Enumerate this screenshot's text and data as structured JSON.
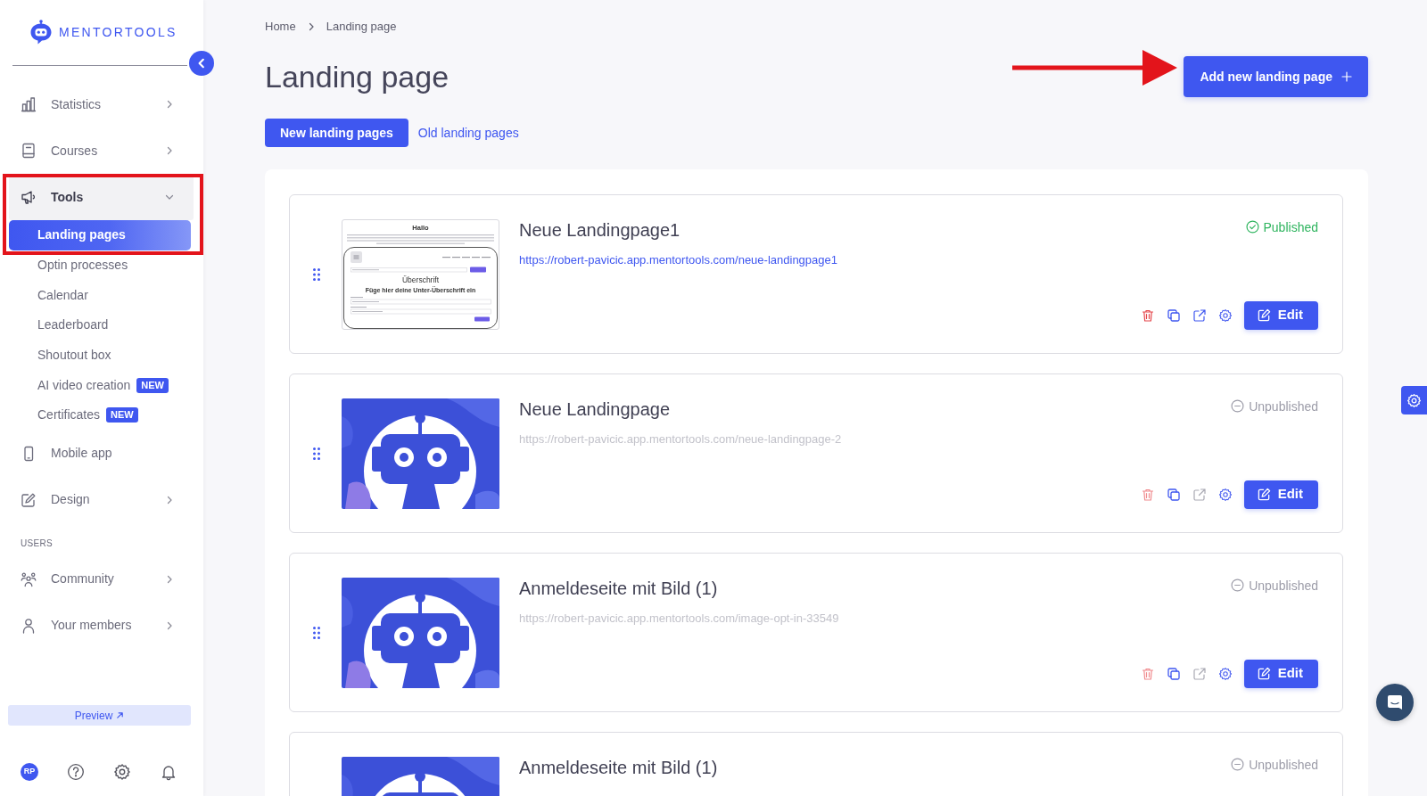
{
  "sidebar": {
    "logo": "MENTORTOOLS",
    "sections": [
      {
        "items": [
          {
            "kind": "group",
            "label": "Statistics",
            "expanded": false
          },
          {
            "kind": "group",
            "label": "Courses",
            "expanded": false
          },
          {
            "kind": "group",
            "label": "Tools",
            "expanded": true,
            "annotated": true,
            "children": [
              {
                "label": "Landing pages",
                "selected": true
              },
              {
                "label": "Optin processes",
                "selected": false
              },
              {
                "label": "Calendar",
                "selected": false
              },
              {
                "label": "Leaderboard",
                "selected": false
              },
              {
                "label": "Shoutout box",
                "selected": false
              },
              {
                "label": "AI video creation",
                "selected": false,
                "badge": "NEW"
              },
              {
                "label": "Certificates",
                "selected": false,
                "badge": "NEW"
              }
            ]
          },
          {
            "kind": "link",
            "label": "Mobile app"
          },
          {
            "kind": "group",
            "label": "Design",
            "expanded": false
          }
        ]
      },
      {
        "heading": "USERS",
        "items": [
          {
            "kind": "group",
            "label": "Community",
            "expanded": false
          },
          {
            "kind": "group",
            "label": "Your members",
            "expanded": false
          }
        ]
      }
    ],
    "preview_button": "Preview",
    "user_initials": "RP"
  },
  "breadcrumb": [
    {
      "label": "Home"
    },
    {
      "label": "Landing page"
    }
  ],
  "title": "Landing page",
  "add_button": {
    "label": "Add new landing page",
    "annotated": true
  },
  "tabs": [
    {
      "label": "New landing pages",
      "selected": true
    },
    {
      "label": "Old landing pages",
      "selected": false
    }
  ],
  "landing_pages": [
    {
      "thumbnail": {
        "kind": "page-preview",
        "heading": "Hallo",
        "headline": "Überschrift",
        "subheadline": "Füge hier deine Unter-Überschrift ein"
      },
      "title": "Neue Landingpage1",
      "url": "https://robert-pavicic.app.mentortools.com/neue-landingpage1",
      "published": true,
      "status": "Published",
      "edit_label": "Edit"
    },
    {
      "thumbnail": {
        "kind": "robot"
      },
      "title": "Neue Landingpage",
      "url": "https://robert-pavicic.app.mentortools.com/neue-landingpage-2",
      "published": false,
      "status": "Unpublished",
      "edit_label": "Edit"
    },
    {
      "thumbnail": {
        "kind": "robot"
      },
      "title": "Anmeldeseite mit Bild (1)",
      "url": "https://robert-pavicic.app.mentortools.com/image-opt-in-33549",
      "published": false,
      "status": "Unpublished",
      "edit_label": "Edit"
    },
    {
      "thumbnail": {
        "kind": "robot"
      },
      "title": "Anmeldeseite mit Bild (1)",
      "published": false,
      "status": "Unpublished"
    }
  ]
}
